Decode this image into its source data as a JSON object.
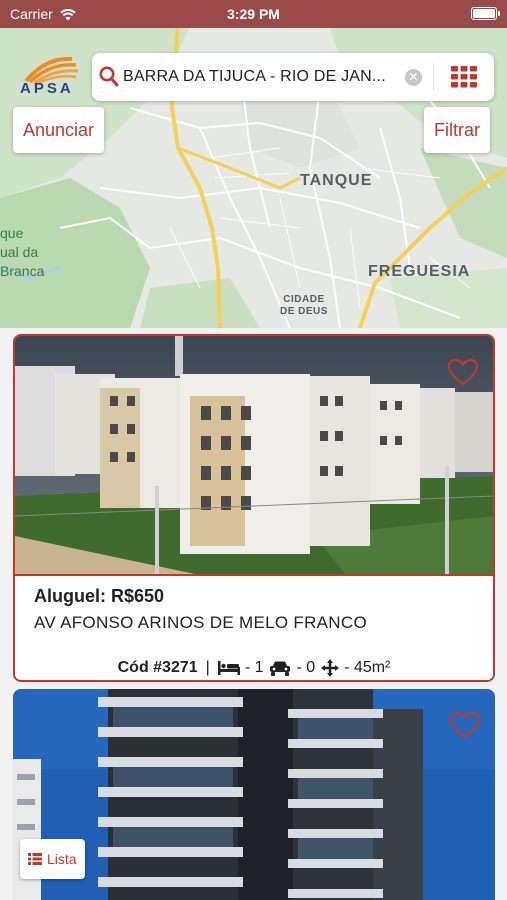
{
  "status_bar": {
    "carrier": "Carrier",
    "time": "3:29 PM"
  },
  "logo": {
    "text": "APSA"
  },
  "map": {
    "labels": {
      "tanque": "TANQUE",
      "freguesia": "FREGUESIA",
      "cidade_line1": "CIDADE",
      "cidade_line2": "DE DEUS",
      "park_line1": "que",
      "park_line2": "ual da",
      "park_line3": "Branca"
    }
  },
  "search": {
    "value": "BARRA DA TIJUCA - RIO DE JAN..."
  },
  "buttons": {
    "anunciar": "Anunciar",
    "filtrar": "Filtrar",
    "lista": "Lista"
  },
  "listings": [
    {
      "price": "Aluguel: R$650",
      "address": "AV AFONSO ARINOS DE MELO FRANCO",
      "code": "Cód #3271",
      "separator": "|",
      "bedrooms": "- 1",
      "parking": "- 0",
      "area": "- 45m²"
    }
  ],
  "colors": {
    "accent": "#c0392b",
    "status_bar": "#9b4a4a",
    "brand_blue": "#2b3f8c"
  }
}
